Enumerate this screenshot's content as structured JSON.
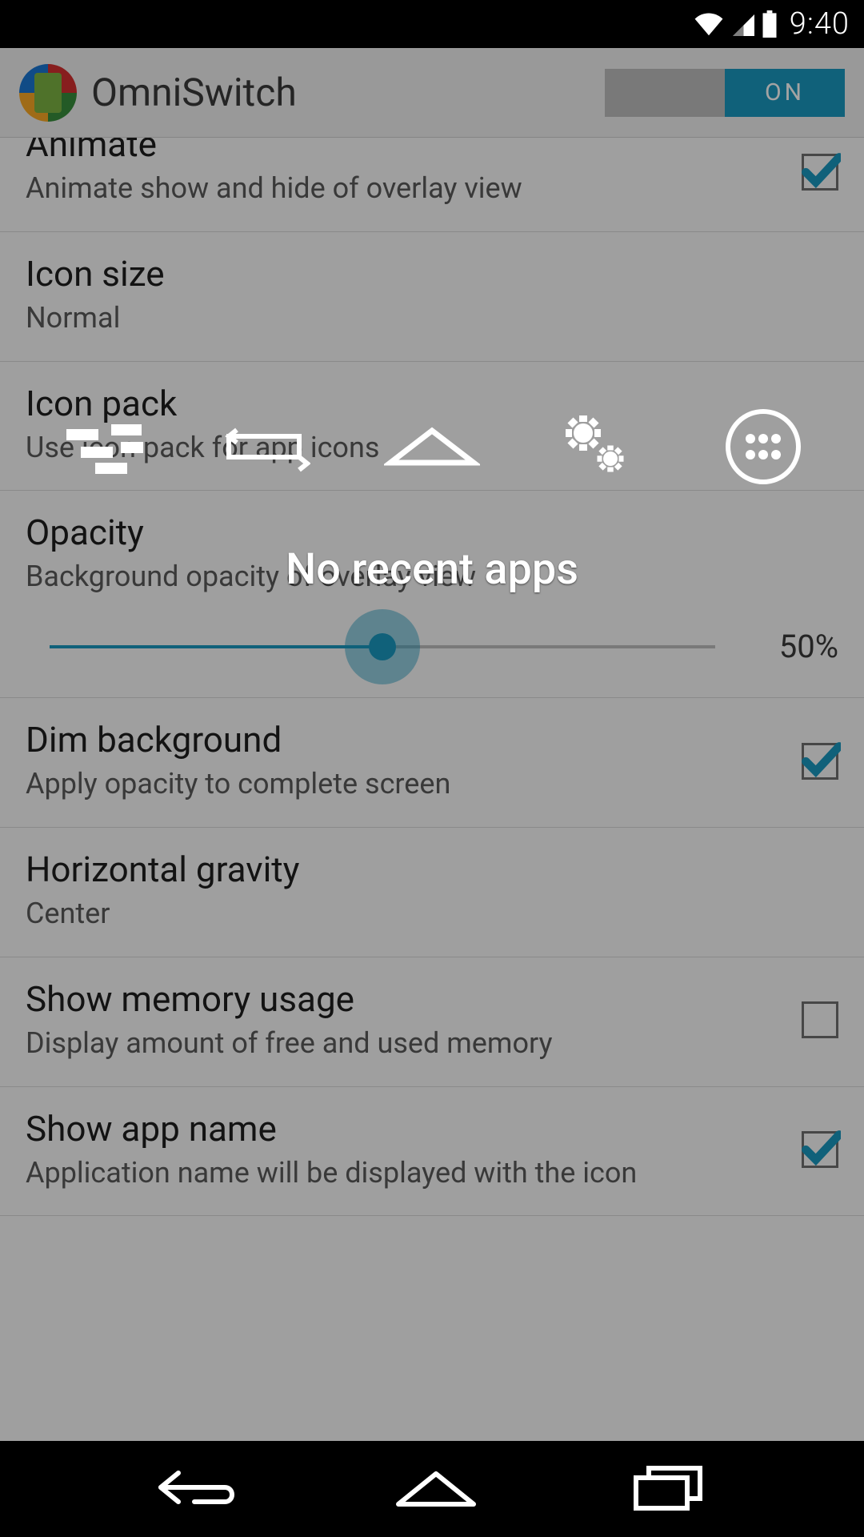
{
  "statusbar": {
    "time": "9:40"
  },
  "header": {
    "title": "OmniSwitch",
    "toggle_state": "ON"
  },
  "settings": {
    "animate": {
      "title": "Animate",
      "sub": "Animate show and hide of overlay view",
      "checked": true
    },
    "icon_size": {
      "title": "Icon size",
      "sub": "Normal"
    },
    "icon_pack": {
      "title": "Icon pack",
      "sub": "Use icon pack for app icons"
    },
    "opacity": {
      "title": "Opacity",
      "sub": "Background opacity of overlay view",
      "value_label": "50%",
      "percent": 50
    },
    "dim_bg": {
      "title": "Dim background",
      "sub": "Apply opacity to complete screen",
      "checked": true
    },
    "h_gravity": {
      "title": "Horizontal gravity",
      "sub": "Center"
    },
    "memory": {
      "title": "Show memory usage",
      "sub": "Display amount of free and used memory",
      "checked": false
    },
    "app_name": {
      "title": "Show app name",
      "sub": "Application name will be displayed with the icon",
      "checked": true
    }
  },
  "overlay": {
    "message": "No recent apps"
  }
}
